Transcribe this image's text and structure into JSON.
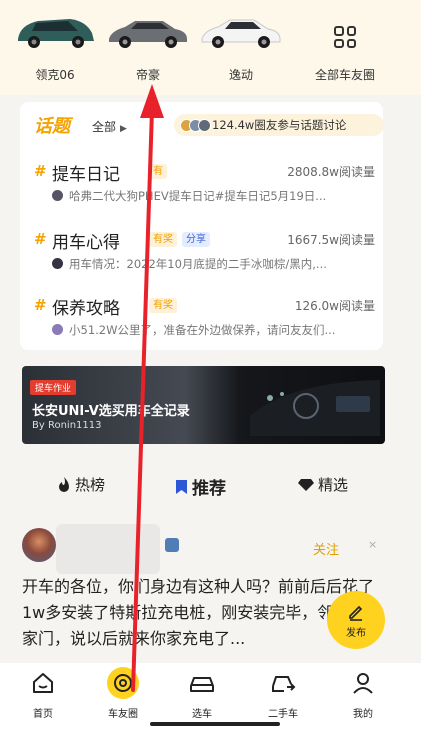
{
  "car_strip": {
    "items": [
      {
        "label": "领克06",
        "icon": "car-green-suv-icon"
      },
      {
        "label": "帝豪",
        "icon": "car-gray-sedan-icon"
      },
      {
        "label": "逸动",
        "icon": "car-white-sedan-icon"
      },
      {
        "label": "全部车友圈",
        "icon": "grid-icon"
      }
    ]
  },
  "topics": {
    "logo": "话题",
    "filter_label": "全部",
    "participants_text": "124.4w圈友参与话题讨论",
    "rows": [
      {
        "title": "提车日记",
        "tag": "有",
        "reads": "2808.8w阅读量",
        "preview": "哈弗二代大狗PHEV提车日记#提车日记5月19日..."
      },
      {
        "title": "用车心得",
        "tag": "有奖",
        "tag2": "分享",
        "reads": "1667.5w阅读量",
        "preview": "用车情况：2022年10月底提的二手冰咖棕/黑内,..."
      },
      {
        "title": "保养攻略",
        "tag": "有奖",
        "reads": "126.0w阅读量",
        "preview": "小51.2W公里了，准备在外边做保养，请问友友们..."
      }
    ]
  },
  "banner": {
    "tag": "提车作业",
    "title": "长安UNI-V选买用车全记录",
    "byline": "By Ronin1113"
  },
  "feed_tabs": [
    {
      "label": "热榜",
      "icon": "flame-icon",
      "active": false
    },
    {
      "label": "推荐",
      "icon": "bookmark-icon",
      "active": true
    },
    {
      "label": "精选",
      "icon": "diamond-icon",
      "active": false
    }
  ],
  "post": {
    "follow_label": "关注",
    "close_label": "×",
    "body": "开车的各位，你们身边有这种人吗？前前后后花了1w多安装了特斯拉充电桩，刚安装完毕，邻居敲我家门，说以后就来你家充电了..."
  },
  "publish_label": "发布",
  "bottom_nav": [
    {
      "label": "首页",
      "icon": "home-icon"
    },
    {
      "label": "车友圈",
      "icon": "steering-wheel-icon"
    },
    {
      "label": "选车",
      "icon": "car-icon"
    },
    {
      "label": "二手车",
      "icon": "used-car-icon"
    },
    {
      "label": "我的",
      "icon": "profile-icon"
    }
  ],
  "colors": {
    "accent": "#ffd21f",
    "topic_orange": "#f5a300",
    "arrow_red": "#e8222a"
  }
}
